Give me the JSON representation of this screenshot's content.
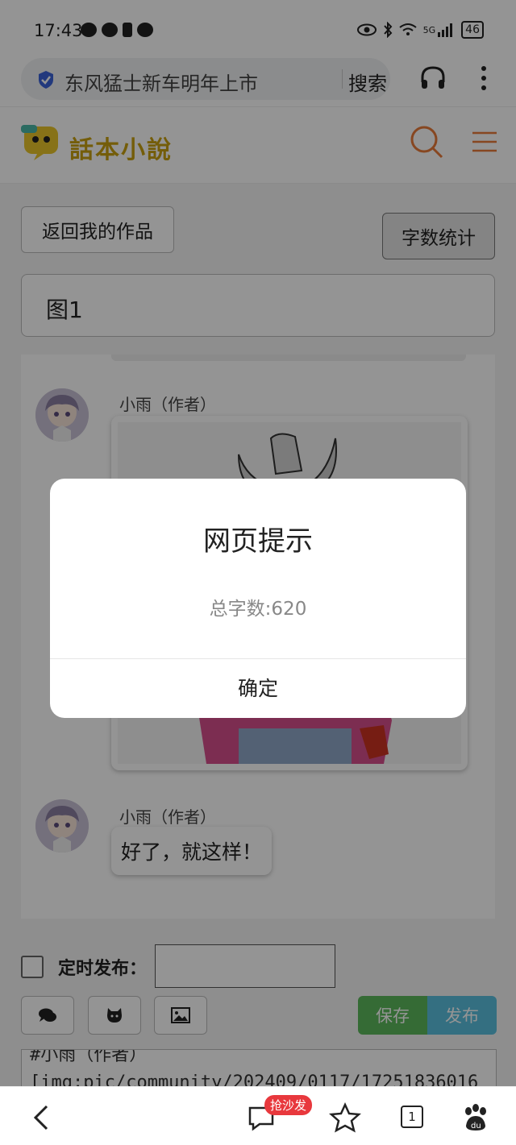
{
  "status_bar": {
    "time": "17:43",
    "network": "5G",
    "battery": "46"
  },
  "browser": {
    "url_text": "东风猛士新车明年上市",
    "search_label": "搜索"
  },
  "site": {
    "logo_text": "話本小說"
  },
  "page": {
    "back_button": "返回我的作品",
    "word_count_button": "字数统计",
    "title_value": "图1"
  },
  "chat": {
    "messages": [
      {
        "author": "小雨（作者）",
        "type": "image"
      },
      {
        "author": "小雨（作者）",
        "text": "好了，就这样！"
      }
    ]
  },
  "publish": {
    "schedule_label": "定时发布：",
    "schedule_value": "",
    "save_label": "保存",
    "publish_label": "发布"
  },
  "editor": {
    "lines": [
      "#小雨（作者）",
      "[img:pic/community/202409/0117/17251836016"
    ]
  },
  "dialog": {
    "title": "网页提示",
    "message": "总字数:620",
    "ok_label": "确定"
  },
  "bottom_nav": {
    "comment_badge": "抢沙发",
    "tab_count": "1"
  },
  "colors": {
    "save": "#5cb85c",
    "publish": "#5bc0de",
    "badge": "#e8383d",
    "accent": "#e87b3a"
  }
}
